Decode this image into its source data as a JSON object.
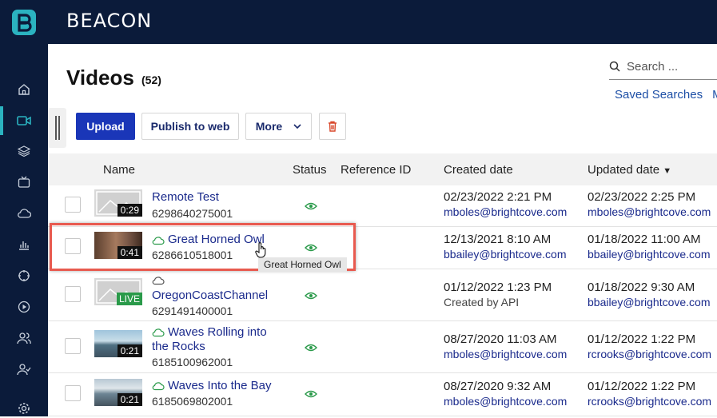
{
  "app": {
    "brand": "BEACON"
  },
  "sidebar": {
    "items": [
      {
        "icon": "home-icon"
      },
      {
        "icon": "video-camera-icon",
        "active": true
      },
      {
        "icon": "layers-icon"
      },
      {
        "icon": "tv-icon"
      },
      {
        "icon": "cloud-icon"
      },
      {
        "icon": "analytics-icon"
      },
      {
        "icon": "target-icon"
      },
      {
        "icon": "play-circle-icon"
      },
      {
        "icon": "users-icon"
      },
      {
        "icon": "user-check-icon"
      },
      {
        "icon": "settings-icon"
      }
    ]
  },
  "page": {
    "title": "Videos",
    "count": "(52)"
  },
  "search": {
    "placeholder": "Search ..."
  },
  "saved_searches": "Saved Searches",
  "saved_searches_overflow": "M",
  "toolbar": {
    "upload_label": "Upload",
    "publish_label": "Publish to web",
    "more_label": "More"
  },
  "table": {
    "headers": {
      "name": "Name",
      "status": "Status",
      "reference_id": "Reference ID",
      "created": "Created date",
      "updated": "Updated date"
    },
    "sort_indicator": "▼",
    "rows": [
      {
        "name": "Remote Test",
        "id": "6298640275001",
        "duration": "0:29",
        "thumb": "placeholder",
        "cloud": false,
        "created_date": "02/23/2022 2:21 PM",
        "created_by": "mboles@brightcove.com",
        "updated_date": "02/23/2022 2:25 PM",
        "updated_by": "mboles@brightcove.com"
      },
      {
        "name": "Great Horned Owl",
        "id": "6286610518001",
        "duration": "0:41",
        "thumb": "owl",
        "cloud": true,
        "created_date": "12/13/2021 8:10 AM",
        "created_by": "bbailey@brightcove.com",
        "updated_date": "01/18/2022 11:00 AM",
        "updated_by": "bbailey@brightcove.com"
      },
      {
        "name": "OregonCoastChannel",
        "id": "6291491400001",
        "duration": "LIVE",
        "thumb": "placeholder",
        "cloud": true,
        "created_date": "01/12/2022 1:23 PM",
        "created_by": "Created by API",
        "updated_date": "01/18/2022 9:30 AM",
        "updated_by": "bbailey@brightcove.com"
      },
      {
        "name_line1": "Waves Rolling into",
        "name_line2": "the Rocks",
        "id": "6185100962001",
        "duration": "0:21",
        "thumb": "sea",
        "cloud": true,
        "created_date": "08/27/2020 11:03 AM",
        "created_by": "mboles@brightcove.com",
        "updated_date": "01/12/2022 1:22 PM",
        "updated_by": "rcrooks@brightcove.com"
      },
      {
        "name": "Waves Into the Bay",
        "id": "6185069802001",
        "duration": "0:21",
        "thumb": "sea",
        "cloud": true,
        "created_date": "08/27/2020 9:32 AM",
        "created_by": "mboles@brightcove.com",
        "updated_date": "01/12/2022 1:22 PM",
        "updated_by": "rcrooks@brightcove.com"
      }
    ]
  },
  "tooltip": "Great Horned Owl",
  "colors": {
    "nav_bg": "#0b1b3a",
    "accent": "#2bb3c0",
    "primary_button": "#1a36b8",
    "link": "#1a2a8c",
    "status_green": "#2a9a4a",
    "highlight": "#e85a4f"
  }
}
